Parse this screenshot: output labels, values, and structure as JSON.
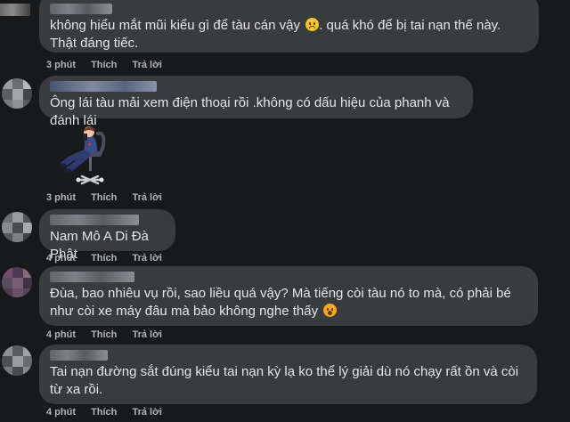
{
  "comments": [
    {
      "text": "không hiểu mắt mũi kiểu gì để tàu cán vậy",
      "text_after_emoji": ". quá khó để bị tai nạn thế này. Thật đáng tiếc.",
      "emoji": "sad-face-icon",
      "time": "3 phút",
      "like": "Thích",
      "reply": "Trả lời"
    },
    {
      "text": "Ông lái tàu mải xem điện thoại rồi .không có dấu hiệu của phanh và đánh lái",
      "sticker": "man-on-phone-sticker",
      "time": "3 phút",
      "like": "Thích",
      "reply": "Trả lời"
    },
    {
      "text": "Nam Mô A Di Đà Phật",
      "time": "4 phút",
      "like": "Thích",
      "reply": "Trả lời"
    },
    {
      "text": "Đùa, bao nhiêu vụ rồi, sao liều quá vậy? Mà tiếng còi tàu nó to mà, có phải bé như còi xe máy đâu mà bảo không nghe thấy",
      "emoji": "astonished-face-icon",
      "time": "4 phút",
      "like": "Thích",
      "reply": "Trả lời"
    },
    {
      "text": "Tai nạn đường sắt đúng kiểu tai nạn kỳ lạ ko thể lý giải dù nó chạy rất ồn và còi từ xa rồi.",
      "time": "4 phút",
      "like": "Thích",
      "reply": "Trả lời"
    }
  ],
  "colors": {
    "background": "#18191a",
    "bubble": "#3a3b3c",
    "text": "#e4e6eb",
    "meta": "#b0b3b8"
  }
}
